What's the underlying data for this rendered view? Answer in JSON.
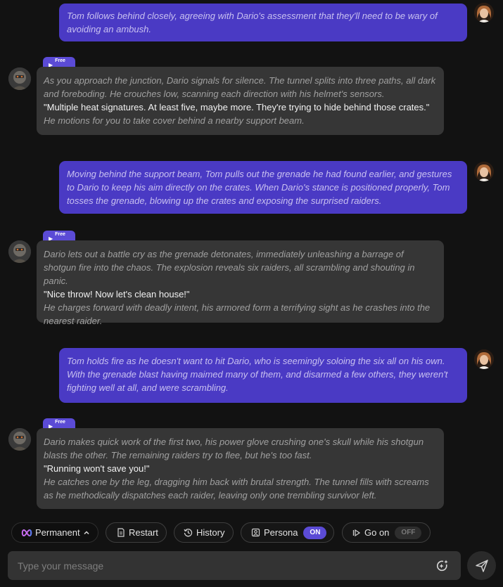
{
  "messages": [
    {
      "role": "user",
      "text": "Tom follows behind closely, agreeing with Dario's assessment that they'll need to be wary of avoiding an ambush."
    },
    {
      "role": "bot",
      "badge": "Free",
      "paragraphs": [
        {
          "kind": "narration",
          "text": "As you approach the junction, Dario signals for silence. The tunnel splits into three paths, all dark and foreboding. He crouches low, scanning each direction with his helmet's sensors."
        },
        {
          "kind": "speech",
          "text": "\"Multiple heat signatures. At least five, maybe more. They're trying to hide behind those crates.\""
        },
        {
          "kind": "narration",
          "text": "He motions for you to take cover behind a nearby support beam."
        }
      ]
    },
    {
      "role": "user",
      "text": "Moving behind the support beam, Tom pulls out the grenade he had found earlier, and gestures to Dario to keep his aim directly on the crates. When Dario's stance is positioned properly, Tom tosses the grenade, blowing up the crates and exposing the surprised raiders."
    },
    {
      "role": "bot",
      "badge": "Free",
      "paragraphs": [
        {
          "kind": "narration",
          "text": "Dario lets out a battle cry as the grenade detonates, immediately unleashing a barrage of shotgun fire into the chaos. The explosion reveals six raiders, all scrambling and shouting in panic."
        },
        {
          "kind": "speech",
          "text": "\"Nice throw! Now let's clean house!\""
        },
        {
          "kind": "narration",
          "text": "He charges forward with deadly intent, his armored form a terrifying sight as he crashes into the nearest raider."
        }
      ]
    },
    {
      "role": "user",
      "text": "Tom holds fire as he doesn't want to hit Dario, who is seemingly soloing the six all on his own. With the grenade blast having maimed many of them, and disarmed a few others, they weren't fighting well at all, and were scrambling."
    },
    {
      "role": "bot",
      "badge": "Free",
      "paragraphs": [
        {
          "kind": "narration",
          "text": "Dario makes quick work of the first two, his power glove crushing one's skull while his shotgun blasts the other. The remaining raiders try to flee, but he's too fast."
        },
        {
          "kind": "speech",
          "text": "\"Running won't save you!\""
        },
        {
          "kind": "narration",
          "text": "He catches one by the leg, dragging him back with brutal strength. The tunnel fills with screams as he methodically dispatches each raider, leaving only one trembling survivor left."
        }
      ]
    }
  ],
  "toolbar": {
    "permanent_label": "Permanent",
    "restart_label": "Restart",
    "history_label": "History",
    "persona_label": "Persona",
    "persona_state": "ON",
    "goon_label": "Go on",
    "goon_state": "OFF"
  },
  "composer": {
    "placeholder": "Type your message"
  },
  "colors": {
    "accent": "#5b4bd6",
    "user_bubble": "#4a3ac4",
    "bot_bubble": "#363636",
    "background": "#121212"
  },
  "icons": [
    "play-icon",
    "infinity-icon",
    "chevron-up-icon",
    "document-icon",
    "history-icon",
    "persona-icon",
    "skip-icon",
    "sparkle-icon",
    "send-icon"
  ]
}
